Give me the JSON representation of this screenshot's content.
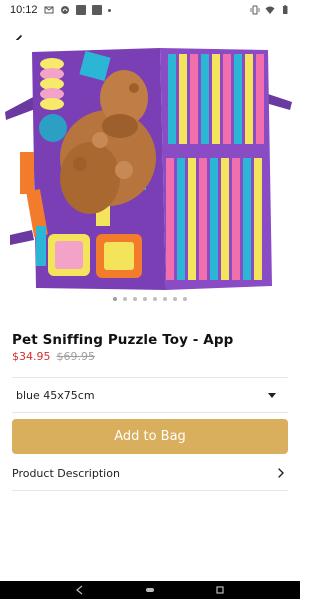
{
  "status_bar": {
    "time": "10:12",
    "left_icons": [
      "gmail-icon",
      "notification-icon",
      "app-icon",
      "app-icon",
      "dot-icon"
    ],
    "right_icons": [
      "vibrate-icon",
      "wifi-icon",
      "battery-icon"
    ]
  },
  "product": {
    "title": "Pet Sniffing Puzzle Toy - App",
    "sale_price": "$34.95",
    "original_price": "$69.95",
    "image_count": 8,
    "active_image_index": 0
  },
  "variant": {
    "selected": "blue 45x75cm"
  },
  "actions": {
    "add_to_bag": "Add to Bag"
  },
  "sections": {
    "description_label": "Product Description"
  },
  "colors": {
    "accent": "#d9ae5c",
    "sale": "#d32f2f",
    "muted": "#9e9e9e"
  }
}
